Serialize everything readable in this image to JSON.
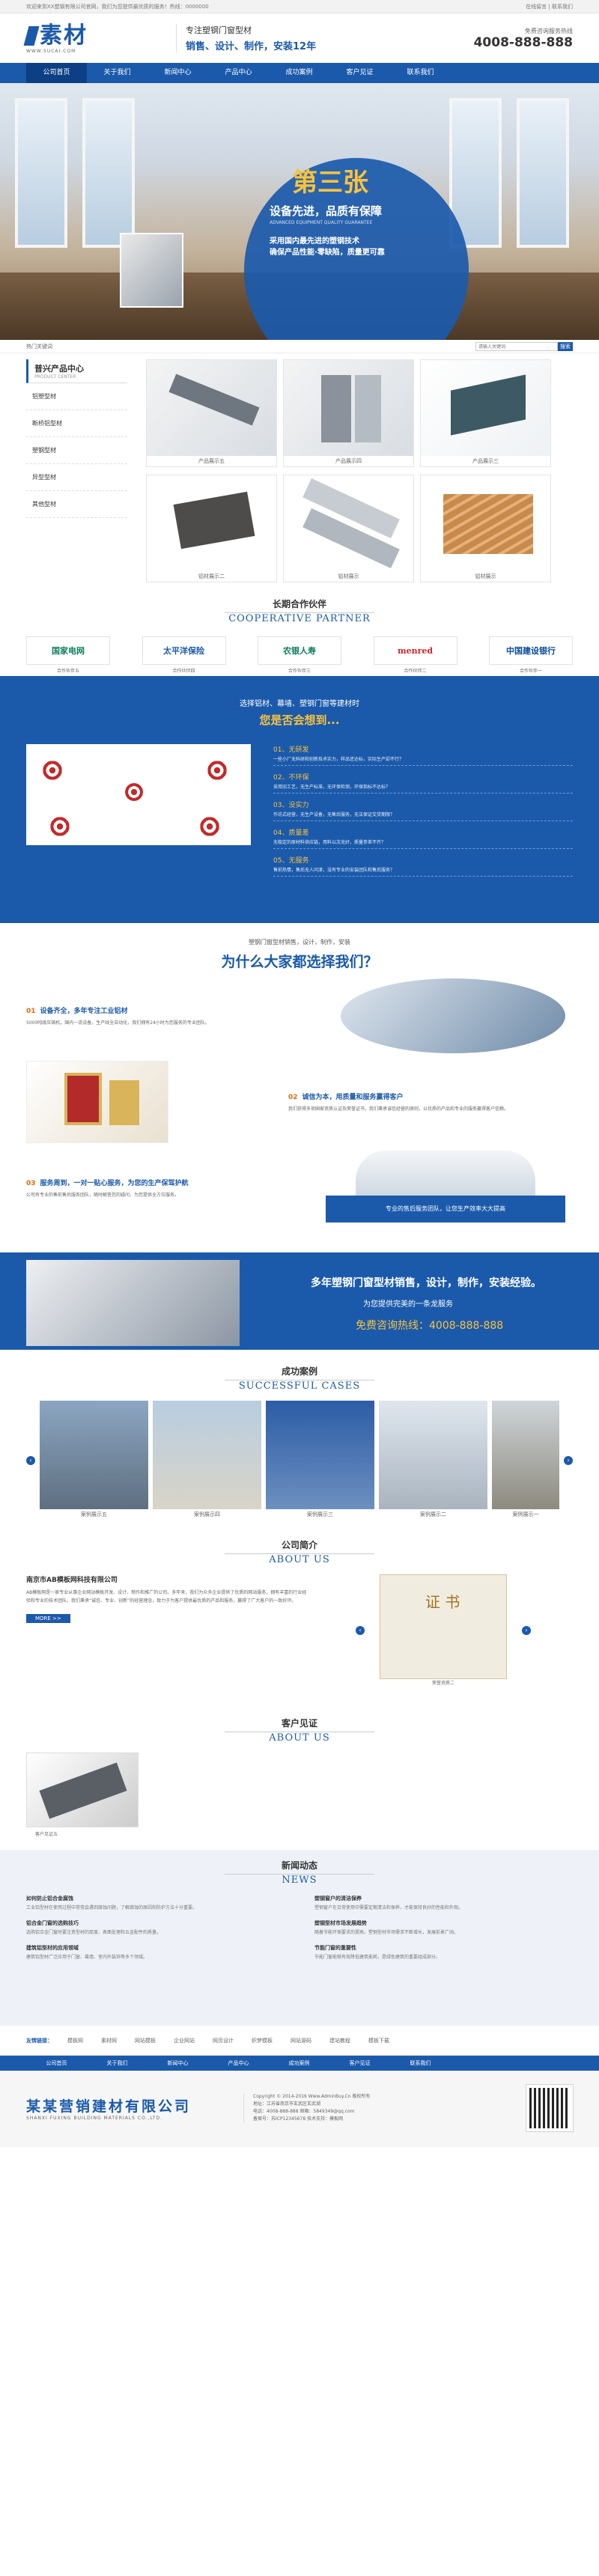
{
  "topbar": {
    "left": "欢迎来到XX塑钢有限公司官网，我们为您提供最优质的服务！热线：0000000",
    "right": "在线留言 | 联系我们"
  },
  "header": {
    "logo": "素材",
    "logo_sub": "WWW.SUCAI.COM",
    "slogan1": "专注塑钢门窗型材",
    "slogan2": "销售、设计、制作，安装12年",
    "hotline_label": "免费咨询服务热线",
    "hotline": "4008-888-888"
  },
  "nav": [
    "公司首页",
    "关于我们",
    "新闻中心",
    "产品中心",
    "成功案例",
    "客户见证",
    "联系我们"
  ],
  "banner": {
    "badge": "第三张",
    "title": "设备先进，品质有保障",
    "sub": "ADVANCED EQUIPMENT QUALITY GUARANTEE",
    "line1": "采用国内最先进的塑钢技术",
    "line2": "确保产品性能·零缺陷，质量更可靠"
  },
  "search": {
    "left": "热门关键词",
    "placeholder": "请输入关键词",
    "button": "搜索"
  },
  "products": {
    "side_title": "普兴产品中心",
    "side_en": "PRODUCT CENTER",
    "categories": [
      "铝塑型材",
      "断桥铝型材",
      "塑钢型材",
      "异型型材",
      "其他型材"
    ],
    "items": [
      "产品展示五",
      "产品展示四",
      "产品展示三",
      "铝材展示二",
      "铝材展示",
      "铝材展示"
    ]
  },
  "partners": {
    "cn": "长期合作伙伴",
    "en": "COOPERATIVE PARTNER",
    "items": [
      {
        "logo": "国家电网",
        "sub": "STATE GRID",
        "name": "合作伙伴五"
      },
      {
        "logo": "太平洋保险",
        "sub": "CPIC",
        "name": "合作伙伴四"
      },
      {
        "logo": "农银人寿",
        "sub": "ABC LIFE",
        "name": "合作伙伴三"
      },
      {
        "logo": "menred",
        "sub": "",
        "name": "合作伙伴二"
      },
      {
        "logo": "中国建设银行",
        "sub": "China Construction Bank",
        "name": "合作伙伴一"
      }
    ]
  },
  "coop": {
    "h1": "选择铝材、幕墙、塑钢门窗等建材时",
    "h2": "您是否会想到...",
    "items": [
      {
        "t": "01、无研发",
        "d": "一些小厂无科研和创新技术实力，样品还达标，实际生产却不行？"
      },
      {
        "t": "02、不环保",
        "d": "采用旧工艺，无生产标准，无环保检测，环保指标不达标？"
      },
      {
        "t": "03、没实力",
        "d": "作坊式经营，无生产设备，无售后服务，无法保证交货期限？"
      },
      {
        "t": "04、质量差",
        "d": "无稳定的原材料供应链，用料以次充好，质量参差不齐？"
      },
      {
        "t": "05、无服务",
        "d": "售前热情，售后无人问津，没有专业的安装团队和售后服务？"
      }
    ]
  },
  "why": {
    "top": "塑钢门窗型材销售，设计，制作，安装",
    "big": "为什么大家都选择我们？",
    "items": [
      {
        "n": "01",
        "t": "设备齐全，多年专注工业铝材",
        "d": "5000吨级压铸机，国内一流设备，生产线全自动化，我们拥有24小时为您服务的专业团队。"
      },
      {
        "n": "02",
        "t": "诚信为本，用质量和服务赢得客户",
        "d": "我们获得多项国家资质认证及荣誉证书，我们秉承诚信经营的原则，以优质的产品和专业的服务赢得客户信赖。"
      },
      {
        "n": "03",
        "t": "服务周到，一对一贴心服务，为您的生产保驾护航",
        "d": "公司有专业的售前售后服务团队，随时解答您的疑问，为您提供全方位服务。"
      }
    ],
    "note": "专业的售后服务团队，让您生产效率大大提高"
  },
  "banner2": {
    "a": "多年塑钢门窗型材销售，设计，制作，安装经验。",
    "b": "为您提供完美的一条龙服务",
    "c": "免费咨询热线：4008-888-888"
  },
  "cases": {
    "cn": "成功案例",
    "en": "SUCCESSFUL CASES",
    "items": [
      "案例展示五",
      "案例展示四",
      "案例展示三",
      "案例展示二",
      "案例展示一"
    ]
  },
  "about": {
    "cn": "公司简介",
    "en": "ABOUT US",
    "title": "南京市AB模板网科技有限公司",
    "desc": "AB模板网是一家专业从事企业网站模板开发、设计、制作和推广的公司。多年来，我们为众多企业提供了优质的网站服务，拥有丰富的行业经验和专业的技术团队。我们秉承“诚信、专业、创新”的经营理念，致力于为客户提供最优质的产品和服务，赢得了广大客户的一致好评。",
    "more": "MORE >>",
    "cert": "荣誉资质二"
  },
  "review": {
    "cn": "客户见证",
    "en": "ABOUT US",
    "item": "客户见证五"
  },
  "news": {
    "cn": "新闻动态",
    "en": "NEWS",
    "items": [
      {
        "t": "如何防止铝合金腐蚀",
        "d": "工业铝型材在使用过程中常常会遇到腐蚀问题，了解腐蚀的原因和防护方法十分重要。"
      },
      {
        "t": "塑钢窗户的清洁保养",
        "d": "塑钢窗户在日常使用中需要定期清洁和保养，才能保持良好的性能和外观。"
      },
      {
        "t": "铝合金门窗的选购技巧",
        "d": "选购铝合金门窗时要注意型材的厚度、表面处理和五金配件的质量。"
      },
      {
        "t": "塑钢型材市场发展趋势",
        "d": "随着节能环保要求的提高，塑钢型材市场需求不断增长，发展前景广阔。"
      },
      {
        "t": "建筑铝型材的应用领域",
        "d": "建筑铝型材广泛应用于门窗、幕墙、室内外装饰等多个领域。"
      },
      {
        "t": "节能门窗的重要性",
        "d": "节能门窗能够有效降低建筑能耗，是绿色建筑的重要组成部分。"
      }
    ]
  },
  "links": {
    "label": "友情链接：",
    "items": [
      "模板网",
      "素材网",
      "网站模板",
      "企业网站",
      "网页设计",
      "织梦模板",
      "网站源码",
      "建站教程",
      "模板下载"
    ]
  },
  "footer": {
    "logo": "某某营销建材有限公司",
    "logo_en": "SHANXI FUXING BUILDING MATERIALS CO.,LTD.",
    "lines": [
      "Copyright © 2014-2016 Www.AdminBuy.Cn 版权所有",
      "地址：江苏省南京市玄武区玄武湖",
      "电话：4008-888-888 邮箱：5849349@qq.com",
      "备案号：苏ICP12345678 技术支持：模板网"
    ]
  }
}
